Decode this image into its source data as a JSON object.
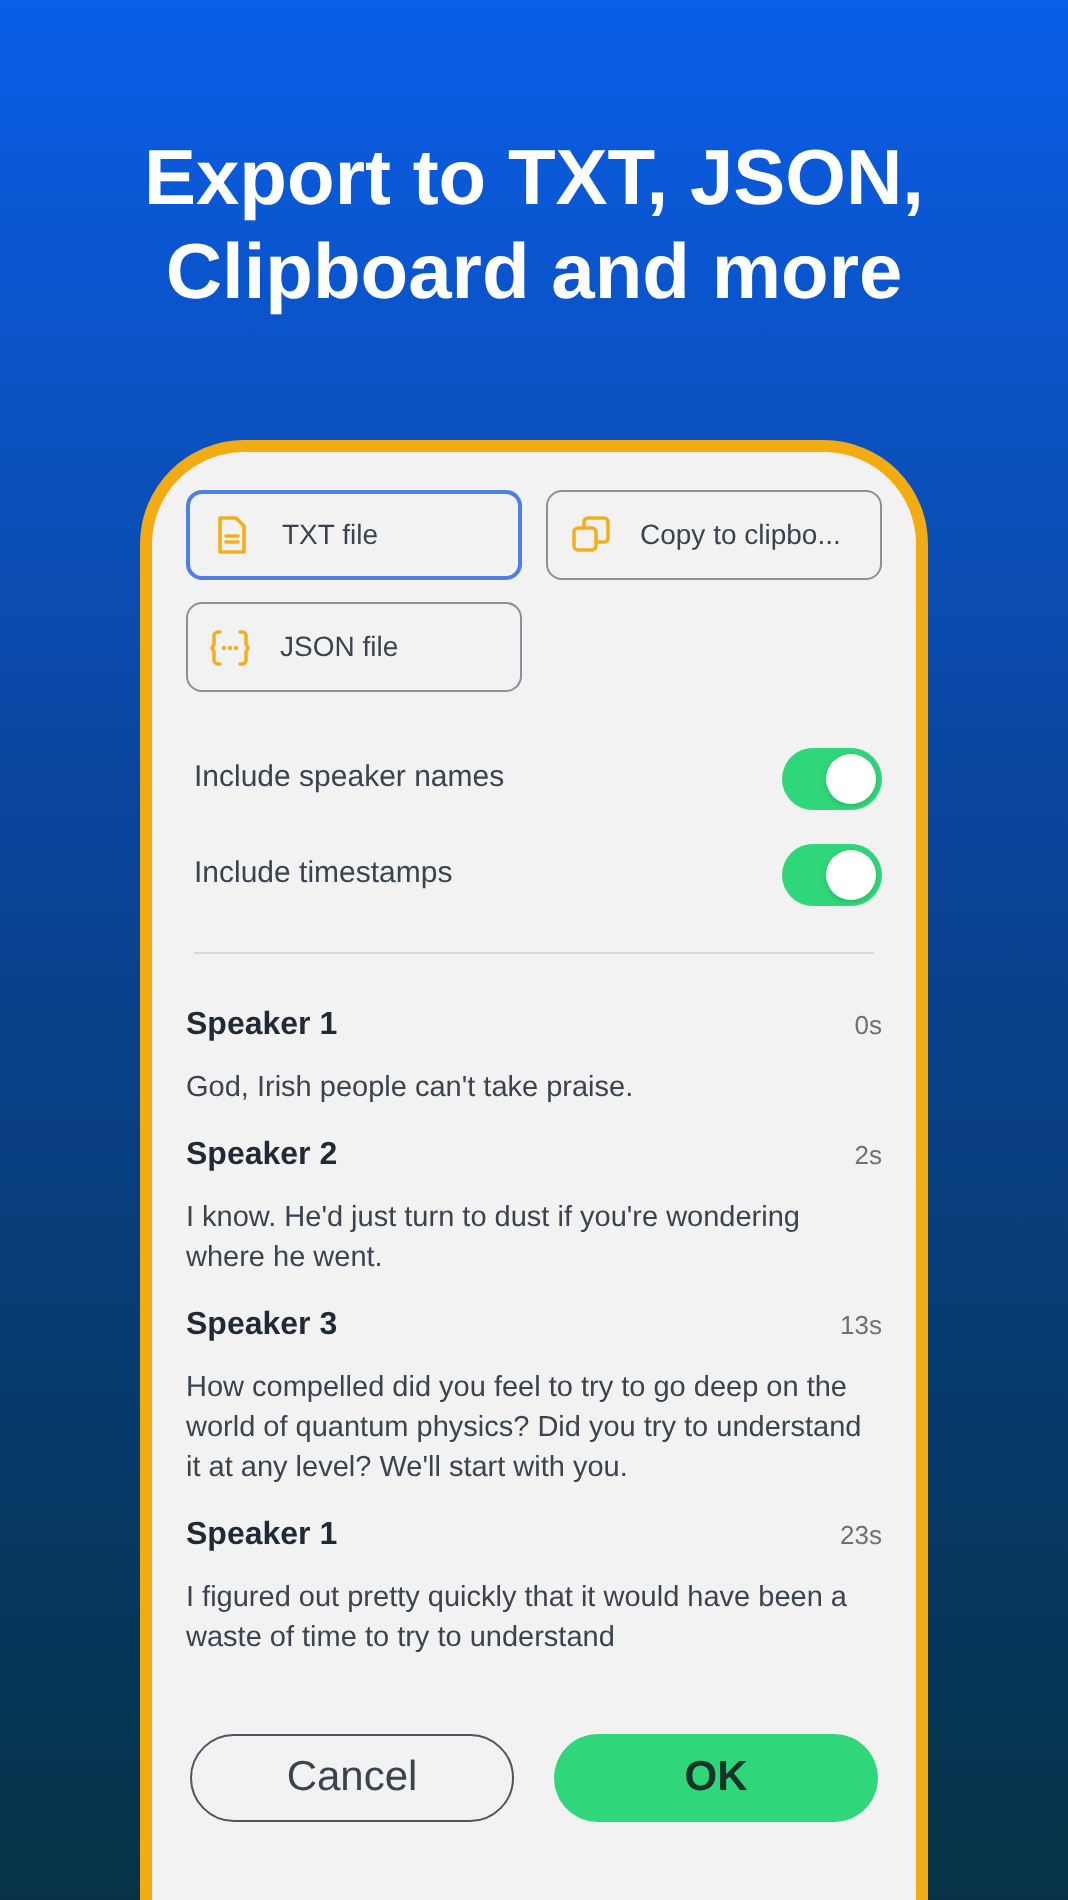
{
  "headline": "Export to TXT, JSON, Clipboard and more",
  "formats": [
    {
      "kind": "txt",
      "label": "TXT file",
      "selected": true
    },
    {
      "kind": "copy",
      "label": "Copy to clipbo...",
      "selected": false
    },
    {
      "kind": "json",
      "label": "JSON file",
      "selected": false
    }
  ],
  "options": [
    {
      "label": "Include speaker names",
      "on": true
    },
    {
      "label": "Include timestamps",
      "on": true
    }
  ],
  "transcript": [
    {
      "speaker": "Speaker 1",
      "time": "0s",
      "text": "God, Irish people can't take praise."
    },
    {
      "speaker": "Speaker 2",
      "time": "2s",
      "text": "I know. He'd just turn to dust if you're wondering where he went."
    },
    {
      "speaker": "Speaker 3",
      "time": "13s",
      "text": "How compelled did you feel to try to go deep on the world of quantum physics? Did you try to understand it at any level? We'll start with you."
    },
    {
      "speaker": "Speaker 1",
      "time": "23s",
      "text": "I figured out pretty quickly that it would have been a waste of time to try to understand"
    }
  ],
  "buttons": [
    {
      "kind": "secondary",
      "label": "Cancel"
    },
    {
      "kind": "primary",
      "label": "OK"
    }
  ]
}
